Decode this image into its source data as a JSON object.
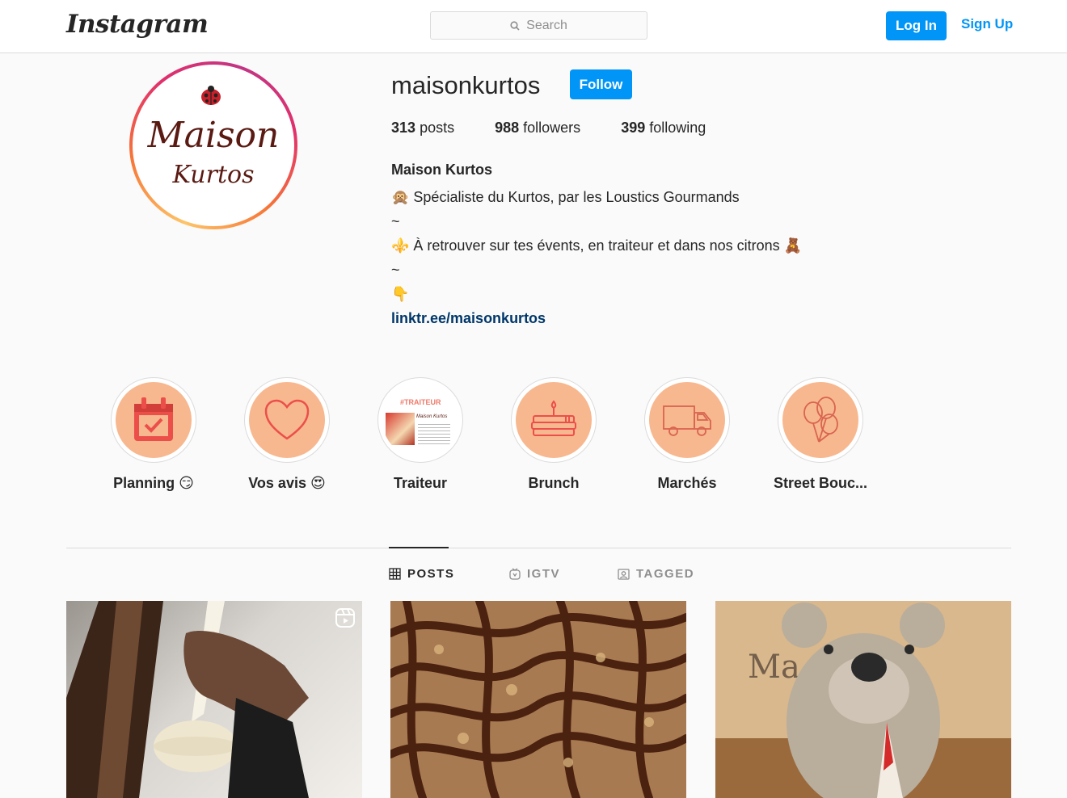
{
  "header": {
    "logo_text": "Instagram",
    "search_placeholder": "Search",
    "login_label": "Log In",
    "signup_label": "Sign Up",
    "accent_color": "#0095f6"
  },
  "profile": {
    "avatar_text_line1": "Maison",
    "avatar_text_line2": "Kurtos",
    "username": "maisonkurtos",
    "follow_label": "Follow",
    "posts_count": "313",
    "posts_label": "posts",
    "followers_count": "988",
    "followers_label": "followers",
    "following_count": "399",
    "following_label": "following",
    "full_name": "Maison Kurtos",
    "bio_lines": [
      "🙊 Spécialiste du Kurtos, par les Loustics Gourmands",
      "~",
      "⚜️ À retrouver sur tes évents, en traiteur et dans nos citrons 🧸",
      "~",
      "👇"
    ],
    "link": "linktr.ee/maisonkurtos"
  },
  "highlights": [
    {
      "label": "Planning 😏",
      "icon": "calendar-check-icon"
    },
    {
      "label": "Vos avis 😍",
      "icon": "heart-icon"
    },
    {
      "label": "Traiteur",
      "icon": "traiteur-thumbnail"
    },
    {
      "label": "Brunch",
      "icon": "cake-icon"
    },
    {
      "label": "Marchés",
      "icon": "truck-icon"
    },
    {
      "label": "Street Bouc...",
      "icon": "balloons-icon"
    }
  ],
  "traiteur_thumb": {
    "tag": "#TRAITEUR",
    "brand": "Maison Kurtos"
  },
  "tabs": [
    {
      "label": "POSTS",
      "icon": "grid-icon",
      "active": true
    },
    {
      "label": "IGTV",
      "icon": "igtv-icon",
      "active": false
    },
    {
      "label": "TAGGED",
      "icon": "tagged-icon",
      "active": false
    }
  ],
  "posts": [
    {
      "type": "reel",
      "icon": "reel-icon"
    },
    {
      "type": "photo"
    },
    {
      "type": "photo"
    }
  ]
}
